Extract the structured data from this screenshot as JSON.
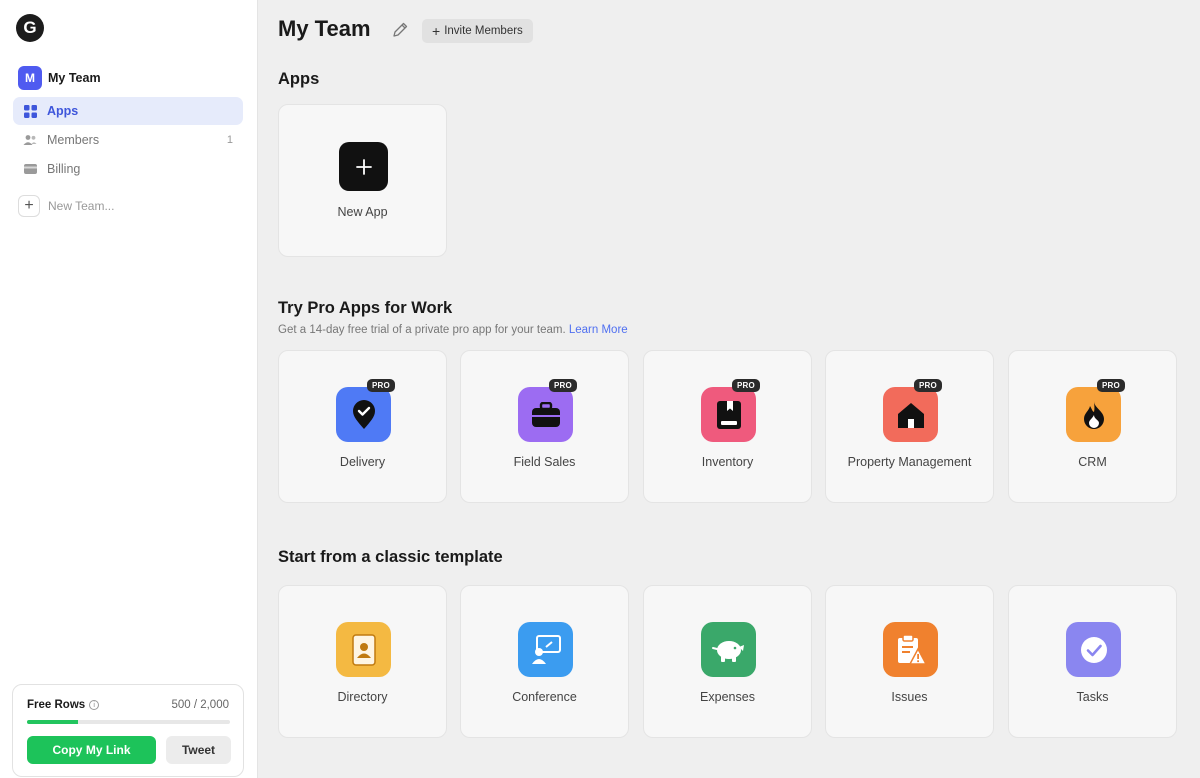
{
  "sidebar": {
    "logo_letter": "G",
    "team": {
      "initial": "M",
      "name": "My Team"
    },
    "nav": [
      {
        "label": "Apps",
        "count": ""
      },
      {
        "label": "Members",
        "count": "1"
      },
      {
        "label": "Billing",
        "count": ""
      }
    ],
    "new_team_label": "New Team...",
    "rows": {
      "title": "Free Rows",
      "count_text": "500 / 2,000",
      "used_fraction": 0.25,
      "copy_label": "Copy My Link",
      "tweet_label": "Tweet"
    }
  },
  "header": {
    "title": "My Team",
    "invite_label": "Invite Members"
  },
  "apps_section": {
    "title": "Apps",
    "new_app_label": "New App"
  },
  "pro_section": {
    "title": "Try Pro Apps for Work",
    "subtitle": "Get a 14-day free trial of a private pro app for your team.",
    "learn_more": "Learn More",
    "badge": "PRO",
    "apps": [
      {
        "label": "Delivery",
        "icon": "map-pin-check-icon",
        "color": "#4f7af5"
      },
      {
        "label": "Field Sales",
        "icon": "briefcase-icon",
        "color": "#9c6cf2"
      },
      {
        "label": "Inventory",
        "icon": "book-icon",
        "color": "#ef5a7d"
      },
      {
        "label": "Property Management",
        "icon": "house-icon",
        "color": "#f26b5b"
      },
      {
        "label": "CRM",
        "icon": "flame-icon",
        "color": "#f7a23c"
      }
    ]
  },
  "template_section": {
    "title": "Start from a classic template",
    "templates": [
      {
        "label": "Directory",
        "icon": "contact-book-icon",
        "color": "#f4b942"
      },
      {
        "label": "Conference",
        "icon": "presentation-icon",
        "color": "#3b9cf0"
      },
      {
        "label": "Expenses",
        "icon": "piggy-bank-icon",
        "color": "#3aa86a"
      },
      {
        "label": "Issues",
        "icon": "clipboard-warning-icon",
        "color": "#f0812e"
      },
      {
        "label": "Tasks",
        "icon": "checkmark-circle-icon",
        "color": "#8a86f0"
      }
    ]
  }
}
